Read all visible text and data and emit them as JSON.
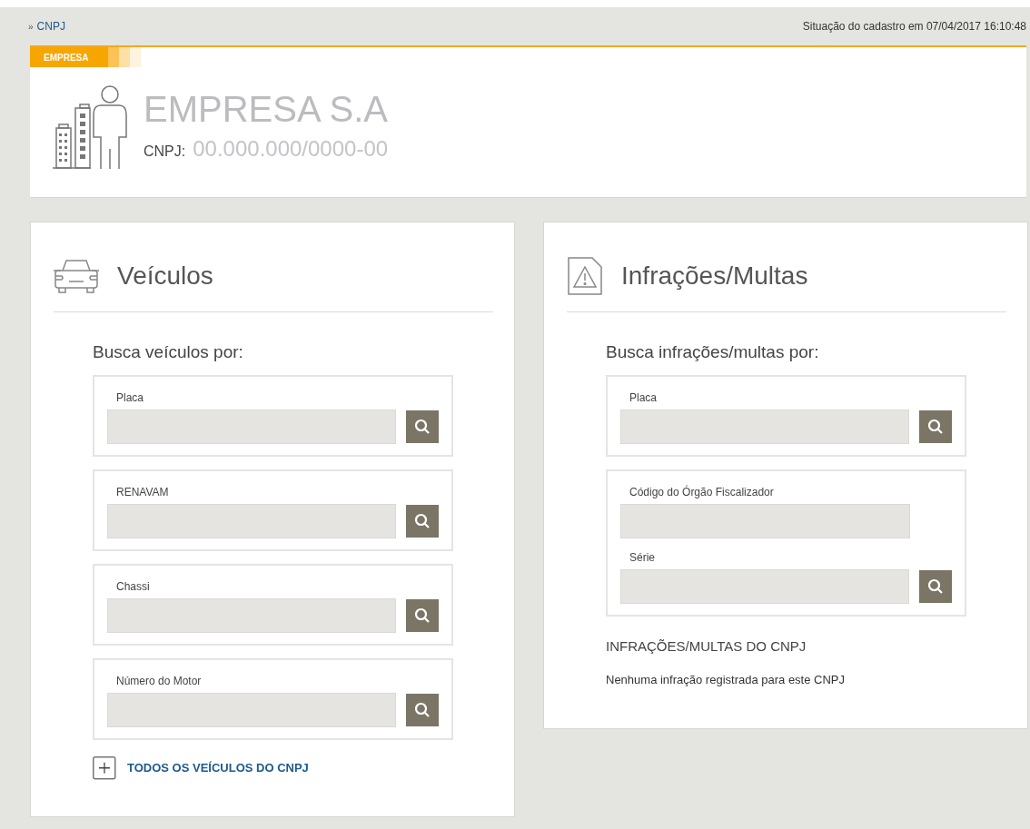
{
  "breadcrumb": {
    "marker": "»",
    "label": "CNPJ"
  },
  "status": "Situação do cadastro em 07/04/2017 16:10:48",
  "company": {
    "tab": "EMPRESA",
    "name": "EMPRESA S.A",
    "id_label": "CNPJ:",
    "id_value": "00.000.000/0000-00"
  },
  "panels": [
    {
      "kind": "vehicles",
      "title": "Veículos",
      "prompt": "Busca veículos por:",
      "groups": [
        {
          "fields": [
            {
              "label": "Placa",
              "search_button": true
            }
          ]
        },
        {
          "fields": [
            {
              "label": "RENAVAM",
              "search_button": true
            }
          ]
        },
        {
          "fields": [
            {
              "label": "Chassi",
              "search_button": true
            }
          ]
        },
        {
          "fields": [
            {
              "label": "Número do Motor",
              "search_button": true
            }
          ]
        }
      ],
      "link": "TODOS OS VEÍCULOS DO CNPJ"
    },
    {
      "kind": "infractions",
      "title": "Infrações/Multas",
      "prompt": "Busca infrações/multas por:",
      "groups": [
        {
          "fields": [
            {
              "label": "Placa",
              "search_button": true
            }
          ]
        },
        {
          "fields": [
            {
              "label": "Código do Órgão Fiscalizador",
              "search_button": false
            },
            {
              "label": "Série",
              "search_button": true
            }
          ]
        }
      ],
      "result_heading": "INFRAÇÕES/MULTAS DO CNPJ",
      "result_text": "Nenhuma infração registrada para este CNPJ"
    }
  ]
}
